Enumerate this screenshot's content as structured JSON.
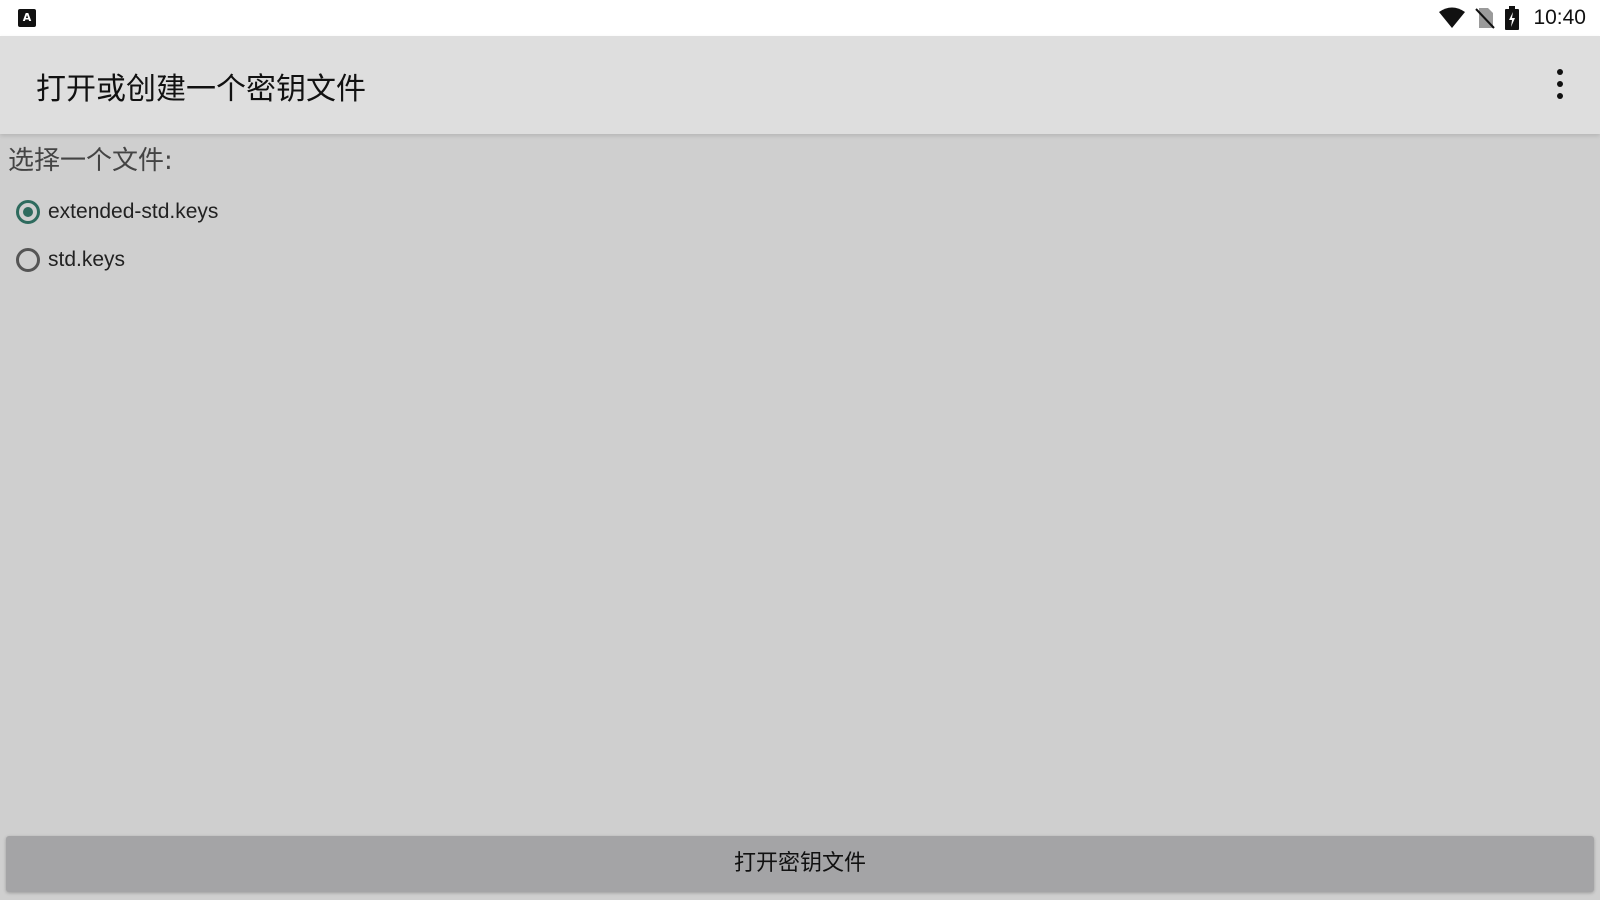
{
  "status_bar": {
    "notification_icon": "accessibility-a-icon",
    "icons": [
      "wifi-icon",
      "no-sim-icon",
      "battery-charging-icon"
    ],
    "time": "10:40"
  },
  "app_bar": {
    "title": "打开或创建一个密钥文件",
    "menu_icon": "more-vert-icon"
  },
  "main": {
    "prompt": "选择一个文件:",
    "options": [
      {
        "label": "extended-std.keys",
        "selected": true
      },
      {
        "label": "std.keys",
        "selected": false
      }
    ],
    "open_button_label": "打开密钥文件"
  },
  "colors": {
    "accent": "#2e6b5e",
    "background": "#cfcfcf",
    "app_bar": "#dedede",
    "button": "#a4a4a6"
  }
}
